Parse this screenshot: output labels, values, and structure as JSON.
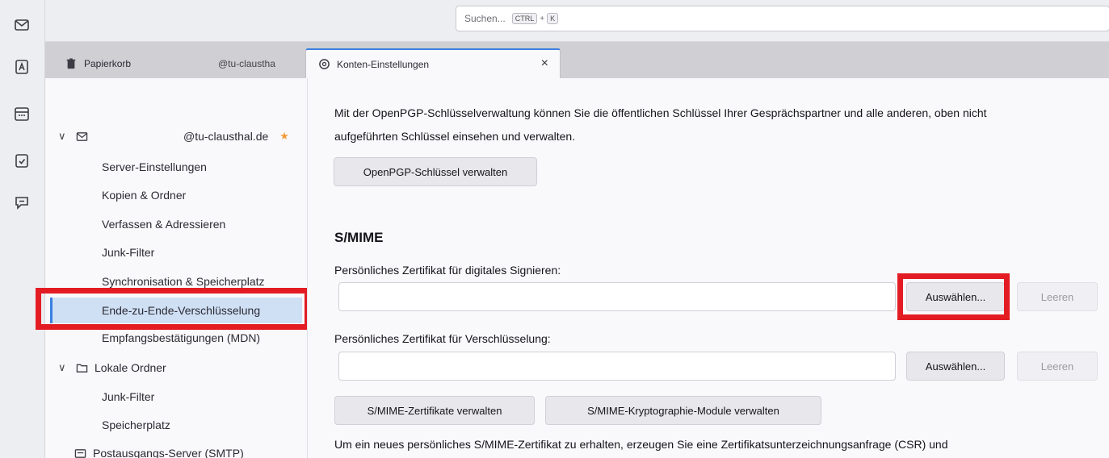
{
  "spaces": {
    "items": [
      {
        "icon": "mail-icon"
      },
      {
        "icon": "address-book-icon"
      },
      {
        "icon": "calendar-icon"
      },
      {
        "icon": "tasks-icon"
      },
      {
        "icon": "chat-icon"
      }
    ]
  },
  "search": {
    "placeholder": "Suchen...",
    "shortcut_mod": "CTRL",
    "shortcut_plus": "+",
    "shortcut_key": "K"
  },
  "tabs": [
    {
      "label": "Papierkorb",
      "icon": "trash-icon"
    },
    {
      "label": "@tu-claustha",
      "icon": ""
    },
    {
      "label": "Konten-Einstellungen",
      "icon": "settings-icon",
      "active": true,
      "close": "×"
    }
  ],
  "tree": {
    "account": {
      "label": "@tu-clausthal.de",
      "chevron": "∨",
      "star": "★"
    },
    "items": [
      "Server-Einstellungen",
      "Kopien & Ordner",
      "Verfassen & Adressieren",
      "Junk-Filter",
      "Synchronisation & Speicherplatz",
      "Ende-zu-Ende-Verschlüsselung",
      "Empfangsbestätigungen (MDN)"
    ],
    "local": {
      "label": "Lokale Ordner",
      "chevron": "∨"
    },
    "local_items": [
      "Junk-Filter",
      "Speicherplatz"
    ],
    "smtp": "Postausgangs-Server (SMTP)"
  },
  "main": {
    "intro_line1": "Mit der OpenPGP-Schlüsselverwaltung können Sie die öffentlichen Schlüssel Ihrer Gesprächspartner und alle anderen, oben nicht",
    "intro_line2": "aufgeführten Schlüssel einsehen und verwalten.",
    "openpgp_button": "OpenPGP-Schlüssel verwalten",
    "smime_heading": "S/MIME",
    "sign_label": "Persönliches Zertifikat für digitales Signieren:",
    "sign_select": "Auswählen...",
    "sign_clear": "Leeren",
    "enc_label": "Persönliches Zertifikat für Verschlüsselung:",
    "enc_select": "Auswählen...",
    "enc_clear": "Leeren",
    "certs_button": "S/MIME-Zertifikate verwalten",
    "crypto_button": "S/MIME-Kryptographie-Module verwalten",
    "footer_line1": "Um ein neues persönliches S/MIME-Zertifikat zu erhalten, erzeugen Sie eine Zertifikatsunterzeichnungsanfrage (CSR) und"
  },
  "colors": {
    "highlight": "#e31c24",
    "selection": "#cfe0f5",
    "accent": "#3b7ee0"
  }
}
